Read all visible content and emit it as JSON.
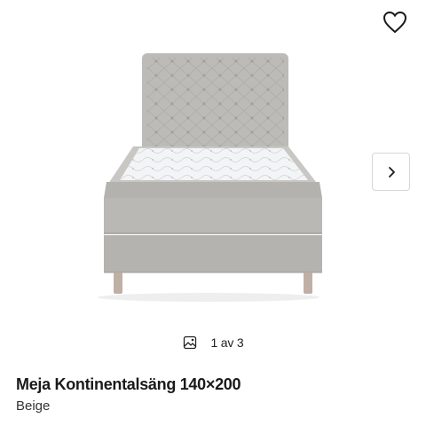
{
  "gallery": {
    "image_alt": "Meja Kontinentalsäng 140×200",
    "counter": "1 av 3",
    "image_icon": "image-gallery-icon",
    "favorite_icon": "heart-icon",
    "next_icon": "chevron-right-icon"
  },
  "product": {
    "title": "Meja Kontinentalsäng 140×200",
    "variant": "Beige"
  },
  "colors": {
    "fabric": "#b9b7b3",
    "fabric_dark": "#a5a39f",
    "mattress": "#eef0f2",
    "leg": "#b8a9a0"
  }
}
